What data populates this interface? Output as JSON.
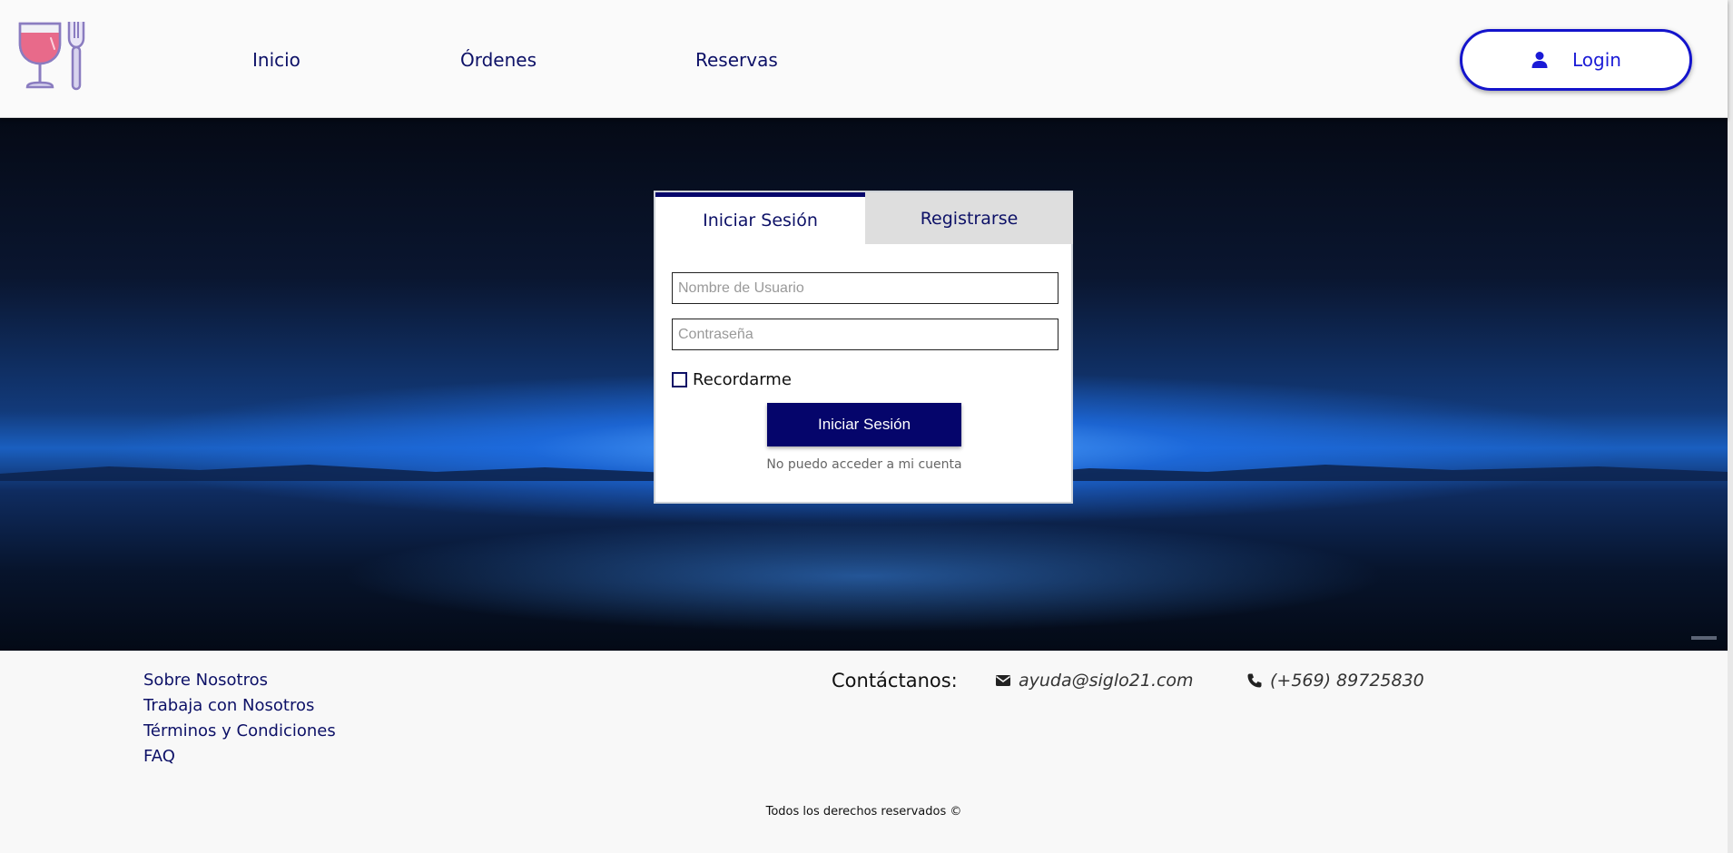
{
  "header": {
    "logo_icon": "wine-glass-and-fork-icon",
    "nav": [
      {
        "label": "Inicio"
      },
      {
        "label": "Órdenes"
      },
      {
        "label": "Reservas"
      }
    ],
    "login_button": {
      "label": "Login",
      "icon": "user-icon"
    }
  },
  "login_card": {
    "tabs": [
      {
        "label": "Iniciar Sesión",
        "active": true
      },
      {
        "label": "Registrarse",
        "active": false
      }
    ],
    "username_placeholder": "Nombre de Usuario",
    "username_value": "",
    "password_placeholder": "Contraseña",
    "password_value": "",
    "remember_label": "Recordarme",
    "remember_checked": false,
    "submit_label": "Iniciar Sesión",
    "forgot_link": "No puedo acceder a mi cuenta"
  },
  "footer": {
    "links": [
      {
        "label": "Sobre Nosotros"
      },
      {
        "label": "Trabaja con Nosotros"
      },
      {
        "label": "Términos y Condiciones"
      },
      {
        "label": "FAQ"
      }
    ],
    "contact_title": "Contáctanos:",
    "email": {
      "value": "ayuda@siglo21.com",
      "icon": "envelope-icon"
    },
    "phone": {
      "value": "(+569) 89725830",
      "icon": "phone-icon"
    },
    "copyright": "Todos los derechos reservados ©"
  },
  "colors": {
    "brand_navy": "#0d1167",
    "button_navy": "#05056b",
    "login_outline": "#1414cc"
  }
}
